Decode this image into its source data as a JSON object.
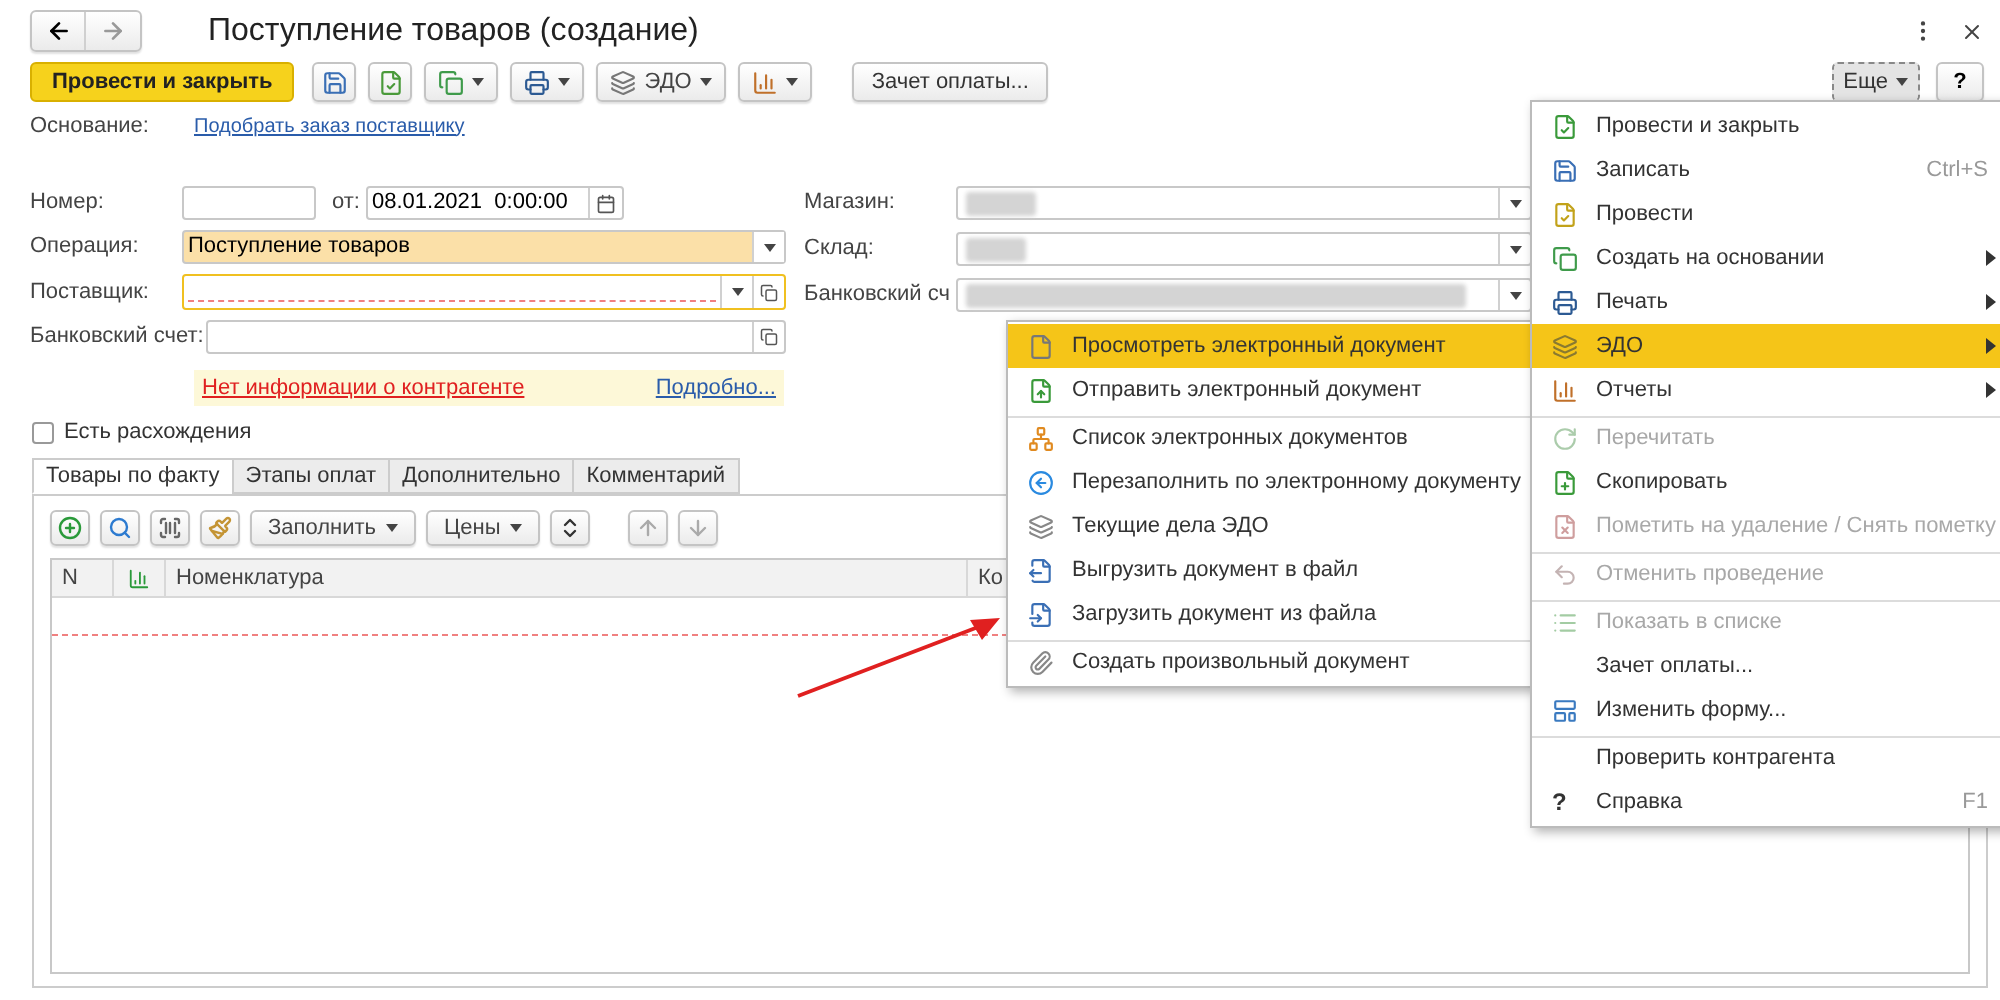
{
  "title": "Поступление товаров (создание)",
  "toolbar": [
    {
      "kind": "primary",
      "label": "Провести и закрыть"
    },
    {
      "kind": "icon"
    },
    {
      "kind": "icon"
    },
    {
      "kind": "icon-menu"
    },
    {
      "kind": "icon-menu"
    },
    {
      "kind": "icon-menu",
      "label": "ЭДО"
    },
    {
      "kind": "icon-menu"
    },
    {
      "kind": "text",
      "label": "Зачет оплаты..."
    }
  ],
  "more_button": {
    "label": "Еще",
    "pressed": true
  },
  "help_button": {
    "label": "?"
  },
  "basis": {
    "label": "Основание:",
    "link": "Подобрать заказ поставщику"
  },
  "form": {
    "number": {
      "label": "Номер:"
    },
    "date": {
      "label": "от:",
      "value": "08.01.2021  0:00:00"
    },
    "operation": {
      "label": "Операция:",
      "value": "Поступление товаров",
      "highlighted": true
    },
    "supplier": {
      "label": "Поставщик:",
      "focused": true,
      "required": true
    },
    "bank_account": {
      "label": "Банковский счет:"
    },
    "store": {
      "label": "Магазин:"
    },
    "warehouse": {
      "label": "Склад:"
    },
    "store_bank_account": {
      "label": "Банковский сч"
    }
  },
  "notice": {
    "text": "Нет информации о контрагенте",
    "link": "Подробно..."
  },
  "discrepancy": {
    "label": "Есть расхождения",
    "checked": false
  },
  "tabs": [
    {
      "label": "Товары по факту",
      "selected": true
    },
    {
      "label": "Этапы оплат",
      "selected": false
    },
    {
      "label": "Дополнительно",
      "selected": false
    },
    {
      "label": "Комментарий",
      "selected": false
    }
  ],
  "table_toolbar": [
    {
      "kind": "icon"
    },
    {
      "kind": "icon"
    },
    {
      "kind": "icon"
    },
    {
      "kind": "icon"
    },
    {
      "kind": "menu",
      "label": "Заполнить"
    },
    {
      "kind": "menu",
      "label": "Цены"
    },
    {
      "kind": "icon"
    },
    {
      "kind": "icon"
    },
    {
      "kind": "icon"
    }
  ],
  "table": {
    "columns": [
      {
        "kind": "text",
        "label": "N"
      },
      {
        "kind": "icon"
      },
      {
        "kind": "text",
        "label": "Номенклатура"
      },
      {
        "kind": "text",
        "label": "Ко"
      }
    ]
  },
  "more_menu": [
    {
      "label": "Провести и закрыть",
      "disabled": false,
      "selected": false,
      "has_submenu": false,
      "separator_before": false
    },
    {
      "label": "Записать",
      "shortcut": "Ctrl+S",
      "disabled": false,
      "selected": false,
      "has_submenu": false,
      "separator_before": false
    },
    {
      "label": "Провести",
      "disabled": false,
      "selected": false,
      "has_submenu": false,
      "separator_before": false
    },
    {
      "label": "Создать на основании",
      "disabled": false,
      "selected": false,
      "has_submenu": true,
      "separator_before": false
    },
    {
      "label": "Печать",
      "disabled": false,
      "selected": false,
      "has_submenu": true,
      "separator_before": false
    },
    {
      "label": "ЭДО",
      "disabled": false,
      "selected": true,
      "has_submenu": true,
      "separator_before": false
    },
    {
      "label": "Отчеты",
      "disabled": false,
      "selected": false,
      "has_submenu": true,
      "separator_before": false
    },
    {
      "label": "Перечитать",
      "disabled": true,
      "selected": false,
      "has_submenu": false,
      "separator_before": true
    },
    {
      "label": "Скопировать",
      "disabled": false,
      "selected": false,
      "has_submenu": false,
      "separator_before": false
    },
    {
      "label": "Пометить на удаление / Снять пометку",
      "disabled": true,
      "selected": false,
      "has_submenu": false,
      "separator_before": false
    },
    {
      "label": "Отменить проведение",
      "disabled": true,
      "selected": false,
      "has_submenu": false,
      "separator_before": true
    },
    {
      "label": "Показать в списке",
      "disabled": true,
      "selected": false,
      "has_submenu": false,
      "separator_before": true
    },
    {
      "label": "Зачет оплаты...",
      "disabled": false,
      "selected": false,
      "has_submenu": false,
      "separator_before": false
    },
    {
      "label": "Изменить форму...",
      "disabled": false,
      "selected": false,
      "has_submenu": false,
      "separator_before": false
    },
    {
      "label": "Проверить контрагента",
      "disabled": false,
      "selected": false,
      "has_submenu": false,
      "separator_before": true
    },
    {
      "label": "Справка",
      "glyph": "?",
      "shortcut": "F1",
      "disabled": false,
      "selected": false,
      "has_submenu": false,
      "separator_before": false
    }
  ],
  "edo_menu": [
    {
      "label": "Просмотреть электронный документ",
      "selected": true,
      "separator_before": false
    },
    {
      "label": "Отправить электронный документ",
      "selected": false,
      "separator_before": false
    },
    {
      "label": "Список электронных документов",
      "selected": false,
      "separator_before": true
    },
    {
      "label": "Перезаполнить по электронному документу",
      "selected": false,
      "separator_before": false
    },
    {
      "label": "Текущие дела ЭДО",
      "selected": false,
      "separator_before": false
    },
    {
      "label": "Выгрузить документ в файл",
      "selected": false,
      "separator_before": false
    },
    {
      "label": "Загрузить документ из файла",
      "selected": false,
      "separator_before": false
    },
    {
      "label": "Создать произвольный документ",
      "selected": false,
      "separator_before": true
    }
  ]
}
